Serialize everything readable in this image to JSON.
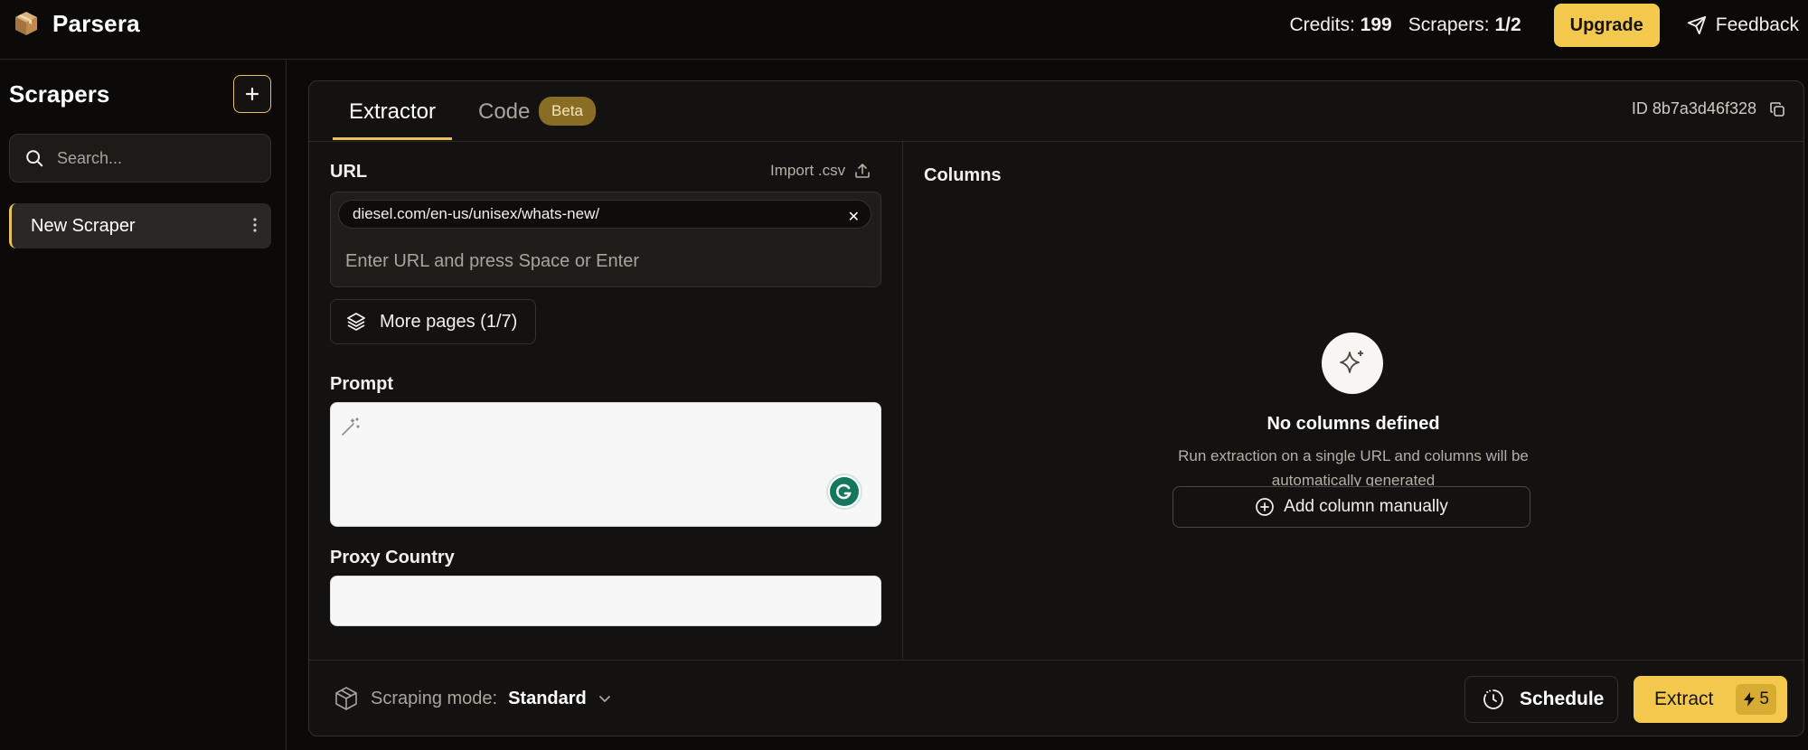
{
  "header": {
    "app_name": "Parsera",
    "credits_label": "Credits:",
    "credits_value": "199",
    "scrapers_label": "Scrapers:",
    "scrapers_value": "1/2",
    "upgrade_label": "Upgrade",
    "feedback_label": "Feedback"
  },
  "sidebar": {
    "title": "Scrapers",
    "search_placeholder": "Search...",
    "items": [
      {
        "label": "New Scraper"
      }
    ]
  },
  "main": {
    "tabs": [
      {
        "label": "Extractor",
        "active": true
      },
      {
        "label": "Code",
        "badge": "Beta"
      }
    ],
    "id_label": "ID 8b7a3d46f328",
    "url_label": "URL",
    "import_label": "Import .csv",
    "url_chip": "diesel.com/en-us/unisex/whats-new/",
    "url_placeholder": "Enter URL and press Space or Enter",
    "more_pages_label": "More pages (1/7)",
    "prompt_label": "Prompt",
    "prompt_value": "",
    "proxy_label": "Proxy Country",
    "proxy_value": "",
    "columns_title": "Columns",
    "empty_title": "No columns defined",
    "empty_desc": "Run extraction on a single URL and columns will be automatically generated",
    "add_column_label": "Add column manually",
    "scraping_mode_label": "Scraping mode:",
    "scraping_mode_value": "Standard",
    "schedule_label": "Schedule",
    "extract_label": "Extract",
    "extract_cost": "5"
  },
  "colors": {
    "accent": "#f2c94c",
    "background": "#0b0a09",
    "panel": "#141210"
  }
}
